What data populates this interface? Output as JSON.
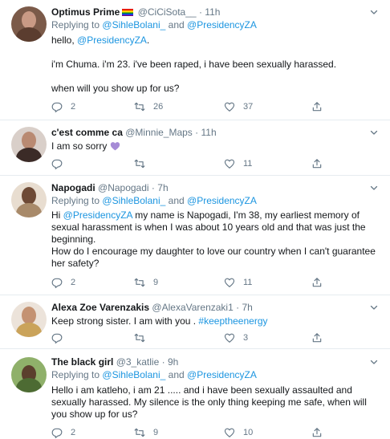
{
  "tweets": [
    {
      "name": "Optimus Prime",
      "handle": "@CiCiSota__",
      "sep": "·",
      "time": "11h",
      "replying_prefix": "Replying to",
      "replying_to": [
        "@SihleBolani_",
        "@PresidencyZA"
      ],
      "replying_and": "and",
      "text": {
        "p1_pre": "hello, ",
        "p1_mention": "@PresidencyZA",
        "p1_post": ".",
        "p2": "i'm Chuma. i'm 23. i've been raped, i have been sexually harassed.",
        "p3": "when will you show up for us?"
      },
      "counts": {
        "replies": "2",
        "retweets": "26",
        "likes": "37"
      }
    },
    {
      "name": "c'est comme ca",
      "handle": "@Minnie_Maps",
      "sep": "·",
      "time": "11h",
      "text": {
        "p1": "I am so sorry"
      },
      "counts": {
        "replies": "",
        "retweets": "",
        "likes": "11"
      }
    },
    {
      "name": "Napogadi",
      "handle": "@Napogadi",
      "sep": "·",
      "time": "7h",
      "replying_prefix": "Replying to",
      "replying_to": [
        "@SihleBolani_",
        "@PresidencyZA"
      ],
      "replying_and": "and",
      "text": {
        "p1_pre": "Hi ",
        "p1_mention": "@PresidencyZA",
        "p1_post": " my name is Napogadi, I'm 38, my earliest memory of sexual harassment is when I was about 10 years old and that was just the beginning.",
        "p2": "How do I encourage my daughter to love our country when I can't guarantee her safety?"
      },
      "counts": {
        "replies": "2",
        "retweets": "9",
        "likes": "11"
      }
    },
    {
      "name": "Alexa Zoe Varenzakis",
      "handle": "@AlexaVarenzaki1",
      "sep": "·",
      "time": "7h",
      "text": {
        "p1_pre": "Keep strong sister. I am with you . ",
        "p1_hashtag": "#keeptheenergy"
      },
      "counts": {
        "replies": "",
        "retweets": "",
        "likes": "3"
      }
    },
    {
      "name": "The black girl",
      "handle": "@3_katlie",
      "sep": "·",
      "time": "9h",
      "replying_prefix": "Replying to",
      "replying_to": [
        "@SihleBolani_",
        "@PresidencyZA"
      ],
      "replying_and": "and",
      "text": {
        "p1": "Hello i am katleho, i am 21 ..... and i have been sexually assaulted and sexually harassed. My silence is the only thing keeping me safe, when will you show up for us?"
      },
      "counts": {
        "replies": "2",
        "retweets": "9",
        "likes": "10"
      }
    }
  ],
  "icons": {
    "reply": "reply-icon",
    "retweet": "retweet-icon",
    "like": "heart-icon",
    "share": "share-icon",
    "more": "chevron-down-icon",
    "flag": "rainbow-flag-icon",
    "emoji": "purple-heart-icon"
  },
  "colors": {
    "link": "#1b95e0",
    "muted": "#657786",
    "text": "#14171a",
    "divider": "#e6ecf0",
    "purple_heart": "#a68bd6"
  }
}
